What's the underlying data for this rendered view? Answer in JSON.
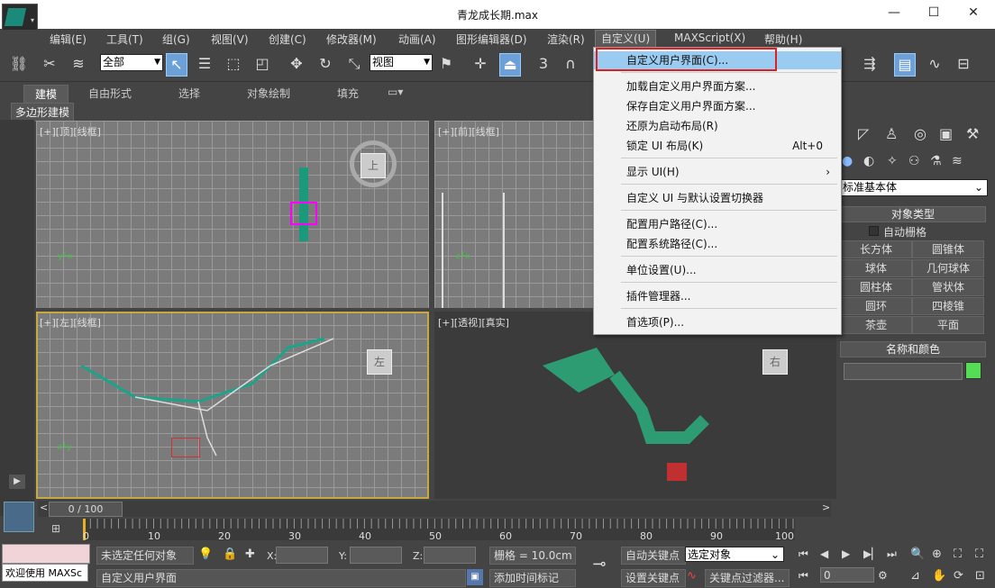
{
  "window": {
    "title": "青龙成长期.max"
  },
  "menu": {
    "items": [
      "编辑(E)",
      "工具(T)",
      "组(G)",
      "视图(V)",
      "创建(C)",
      "修改器(M)",
      "动画(A)",
      "图形编辑器(D)",
      "渲染(R)",
      "自定义(U)",
      "MAXScript(X)",
      "帮助(H)"
    ]
  },
  "toolbar": {
    "selection_filter": "全部",
    "ref_coord": "视图",
    "snap_label": "3"
  },
  "ribbon": {
    "tabs": [
      "建模",
      "自由形式",
      "选择",
      "对象绘制",
      "填充"
    ],
    "sub_label": "多边形建模"
  },
  "viewports": {
    "top": {
      "label": "[+][顶][线框]",
      "cube_face": "上"
    },
    "front": {
      "label": "[+][前][线框]"
    },
    "left": {
      "label": "[+][左][线框]",
      "cube_face": "左"
    },
    "persp": {
      "label": "[+][透视][真实]",
      "cube_face": "右"
    }
  },
  "dropdown": {
    "items": [
      {
        "label": "自定义用户界面(C)...",
        "shortcut": ""
      },
      {
        "label": "加载自定义用户界面方案...",
        "shortcut": ""
      },
      {
        "label": "保存自定义用户界面方案...",
        "shortcut": ""
      },
      {
        "label": "还原为启动布局(R)",
        "shortcut": ""
      },
      {
        "label": "锁定 UI 布局(K)",
        "shortcut": "Alt+0"
      },
      {
        "label": "显示 UI(H)",
        "shortcut": ""
      },
      {
        "label": "自定义 UI 与默认设置切换器",
        "shortcut": ""
      },
      {
        "label": "配置用户路径(C)...",
        "shortcut": ""
      },
      {
        "label": "配置系统路径(C)...",
        "shortcut": ""
      },
      {
        "label": "单位设置(U)...",
        "shortcut": ""
      },
      {
        "label": "插件管理器...",
        "shortcut": ""
      },
      {
        "label": "首选项(P)...",
        "shortcut": ""
      }
    ]
  },
  "command_panel": {
    "category": "标准基本体",
    "rollout_object_type": "对象类型",
    "autogrid": "自动栅格",
    "buttons": [
      "长方体",
      "圆锥体",
      "球体",
      "几何球体",
      "圆柱体",
      "管状体",
      "圆环",
      "四棱锥",
      "茶壶",
      "平面"
    ],
    "rollout_name_color": "名称和颜色",
    "object_color": "#55dd55"
  },
  "timeline": {
    "frame_display": "0 / 100",
    "ticks": [
      "0",
      "10",
      "20",
      "30",
      "40",
      "50",
      "60",
      "70",
      "80",
      "90",
      "100"
    ]
  },
  "status": {
    "welcome": "欢迎使用 MAXSc",
    "selection_status": "未选定任何对象",
    "prompt": "自定义用户界面",
    "x_label": "X:",
    "y_label": "Y:",
    "z_label": "Z:",
    "grid": "栅格 = 10.0cm",
    "add_time_tag": "添加时间标记",
    "auto_key": "自动关键点",
    "set_key": "设置关键点",
    "key_mode": "选定对象",
    "key_filters": "关键点过滤器...",
    "current_frame": "0"
  }
}
